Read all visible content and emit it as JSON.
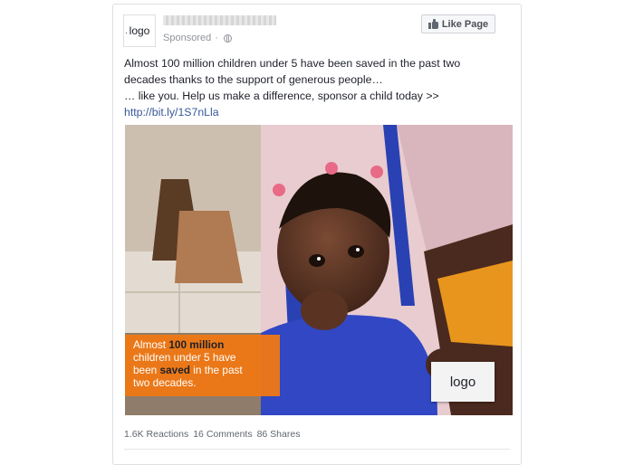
{
  "header": {
    "logo_text": "logo",
    "sponsored_label": "Sponsored",
    "like_button_label": "Like Page",
    "globe_icon": "globe-icon",
    "thumb_icon": "thumbs-up-icon"
  },
  "post": {
    "line1": "Almost 100 million children under 5 have been saved in the past two",
    "line2": "decades thanks to the support of generous people…",
    "line3": "… like you. Help us make a difference, sponsor a child today >>",
    "link": "http://bit.ly/1S7nLla"
  },
  "image_overlay": {
    "t1": "Almost ",
    "t1_hl": "100 million",
    "t2": "children under 5 have",
    "t3a": "been ",
    "t3_hl": "saved",
    "t3b": " in the past",
    "t4": "two decades.",
    "logo_text": "logo",
    "accent_color": "#f07814"
  },
  "stats": {
    "reactions": "1.6K Reactions",
    "comments": "16 Comments",
    "shares": "86 Shares"
  },
  "colors": {
    "link": "#365899",
    "text": "#1d2129",
    "muted": "#90949c"
  }
}
